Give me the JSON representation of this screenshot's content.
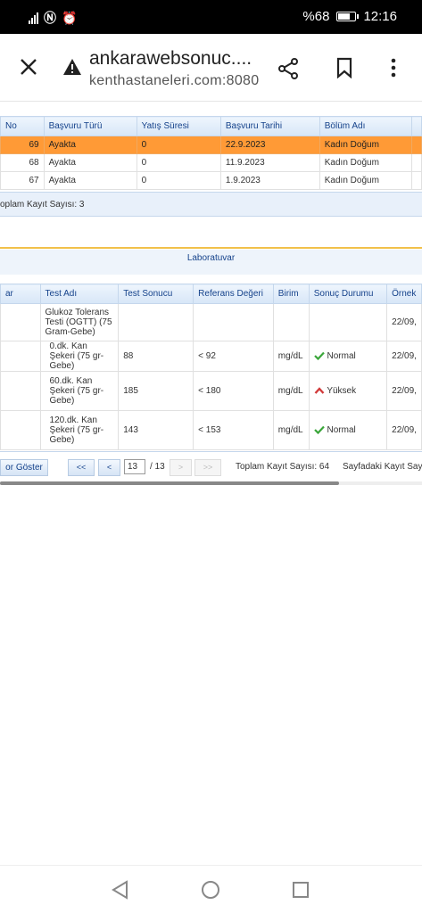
{
  "status": {
    "battery_text": "%68",
    "time": "12:16"
  },
  "browser": {
    "title": "ankarawebsonuc....",
    "url": "kenthastaneleri.com:8080"
  },
  "visits": {
    "headers": [
      "No",
      "Başvuru Türü",
      "Yatış Süresi",
      "Başvuru Tarihi",
      "Bölüm Adı"
    ],
    "rows": [
      {
        "no": "69",
        "type": "Ayakta",
        "stay": "0",
        "date": "22.9.2023",
        "dept": "Kadın Doğum"
      },
      {
        "no": "68",
        "type": "Ayakta",
        "stay": "0",
        "date": "11.9.2023",
        "dept": "Kadın Doğum"
      },
      {
        "no": "67",
        "type": "Ayakta",
        "stay": "0",
        "date": "1.9.2023",
        "dept": "Kadın Doğum"
      }
    ],
    "total_label": "oplam Kayıt Sayısı: 3"
  },
  "lab": {
    "section_title": "Laboratuvar",
    "headers": [
      "ar",
      "Test Adı",
      "Test Sonucu",
      "Referans Değeri",
      "Birim",
      "Sonuç Durumu",
      "Örnek"
    ],
    "rows": [
      {
        "name": "Glukoz Tolerans Testi (OGTT) (75 Gram-Gebe)",
        "result": "",
        "ref": "",
        "unit": "",
        "status": "",
        "status_icon": "",
        "date": "22/09,"
      },
      {
        "name": "0.dk. Kan Şekeri (75 gr-Gebe)",
        "result": "88",
        "ref": "< 92",
        "unit": "mg/dL",
        "status": "Normal",
        "status_icon": "check-icon",
        "date": "22/09,"
      },
      {
        "name": "60.dk. Kan Şekeri (75 gr-Gebe)",
        "result": "185",
        "ref": "< 180",
        "unit": "mg/dL",
        "status": "Yüksek",
        "status_icon": "arrow-up-icon",
        "date": "22/09,"
      },
      {
        "name": "120.dk. Kan Şekeri (75 gr-Gebe)",
        "result": "143",
        "ref": "< 153",
        "unit": "mg/dL",
        "status": "Normal",
        "status_icon": "check-icon",
        "date": "22/09,"
      }
    ],
    "show_button": "or Göster",
    "pager": {
      "first": "<<",
      "prev": "<",
      "page": "13",
      "of": "/ 13",
      "next": ">",
      "last": ">>"
    },
    "total_label": "Toplam Kayıt Sayısı: 64",
    "page_label": "Sayfadaki Kayıt Sayı"
  },
  "colors": {
    "selected_row": "#ff9a36",
    "normal_icon": "#3aa63a",
    "high_icon": "#d23b3b"
  }
}
